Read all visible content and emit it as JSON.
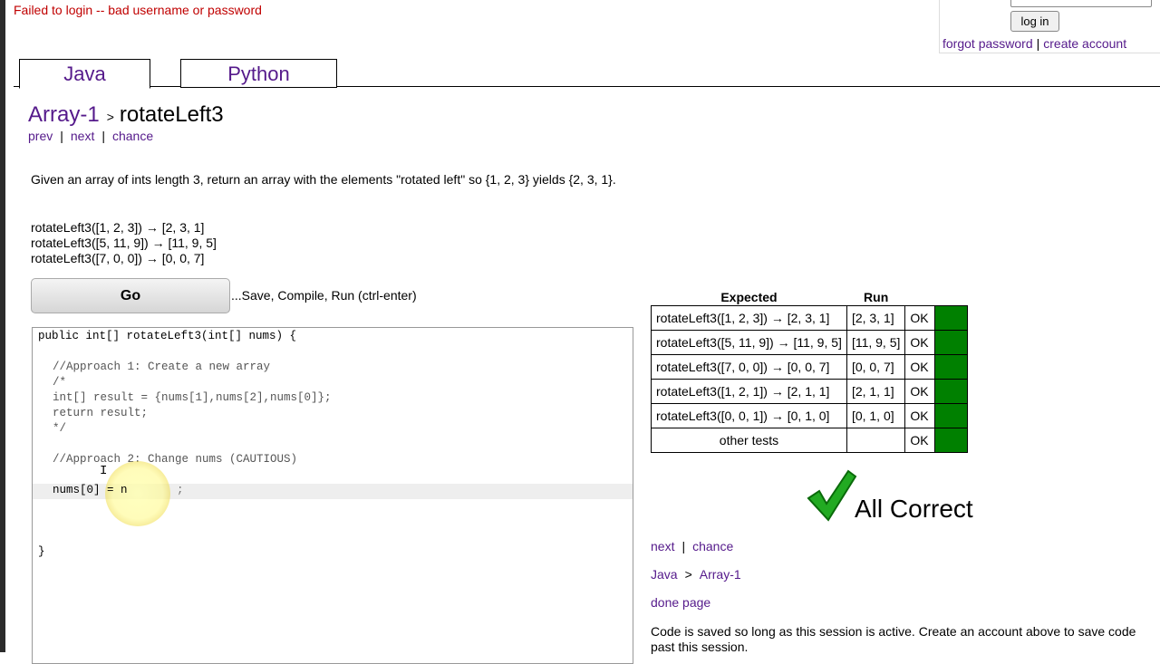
{
  "header": {
    "error": "Failed to login -- bad username or password",
    "login_button": "log in",
    "forgot_password": "forgot password",
    "separator": "|",
    "create_account": "create account"
  },
  "tabs": [
    {
      "label": "Java",
      "active": true
    },
    {
      "label": "Python",
      "active": false
    }
  ],
  "breadcrumb": {
    "section": "Array-1",
    "arrow": ">",
    "problem": "rotateLeft3"
  },
  "subnav": {
    "prev": "prev",
    "sep": "|",
    "next": "next",
    "chance": "chance"
  },
  "description": "Given an array of ints length 3, return an array with the elements \"rotated left\" so {1, 2, 3} yields {2, 3, 1}.",
  "examples": [
    "rotateLeft3([1, 2, 3]) → [2, 3, 1]",
    "rotateLeft3([5, 11, 9]) → [11, 9, 5]",
    "rotateLeft3([7, 0, 0]) → [0, 0, 7]"
  ],
  "go": {
    "label": "Go",
    "hint": "...Save, Compile, Run (ctrl-enter)"
  },
  "code": {
    "l0_kw": "public int[] rotateLeft3(int[] nums) {",
    "l2": "//Approach 1: Create a new array",
    "l3": "/*",
    "l4": "int[] result = {nums[1],nums[2],nums[0]};",
    "l5": "return result;",
    "l6": "*/",
    "l8": "//Approach 2: Change nums (CAUTIOUS)",
    "l10a": "nums[0] = n",
    "l10b": ";",
    "l14": "}"
  },
  "results": {
    "headers": [
      "Expected",
      "Run"
    ],
    "rows": [
      {
        "expected": "rotateLeft3([1, 2, 3]) → [2, 3, 1]",
        "run": "[2, 3, 1]",
        "status": "OK"
      },
      {
        "expected": "rotateLeft3([5, 11, 9]) → [11, 9, 5]",
        "run": "[11, 9, 5]",
        "status": "OK"
      },
      {
        "expected": "rotateLeft3([7, 0, 0]) → [0, 0, 7]",
        "run": "[0, 0, 7]",
        "status": "OK"
      },
      {
        "expected": "rotateLeft3([1, 2, 1]) → [2, 1, 1]",
        "run": "[2, 1, 1]",
        "status": "OK"
      },
      {
        "expected": "rotateLeft3([0, 0, 1]) → [0, 1, 0]",
        "run": "[0, 1, 0]",
        "status": "OK"
      },
      {
        "expected": "other tests",
        "run": "",
        "status": "OK"
      }
    ],
    "pass_color": "#008000"
  },
  "verdict": {
    "icon": "checkmark-icon",
    "text": "All Correct",
    "color": "#22aa22"
  },
  "bottom": {
    "next": "next",
    "sep": "|",
    "chance": "chance",
    "lang": "Java",
    "arrow": ">",
    "section": "Array-1",
    "done": "done page",
    "save_note": "Code is saved so long as this session is active. Create an account above to save code past this session."
  }
}
